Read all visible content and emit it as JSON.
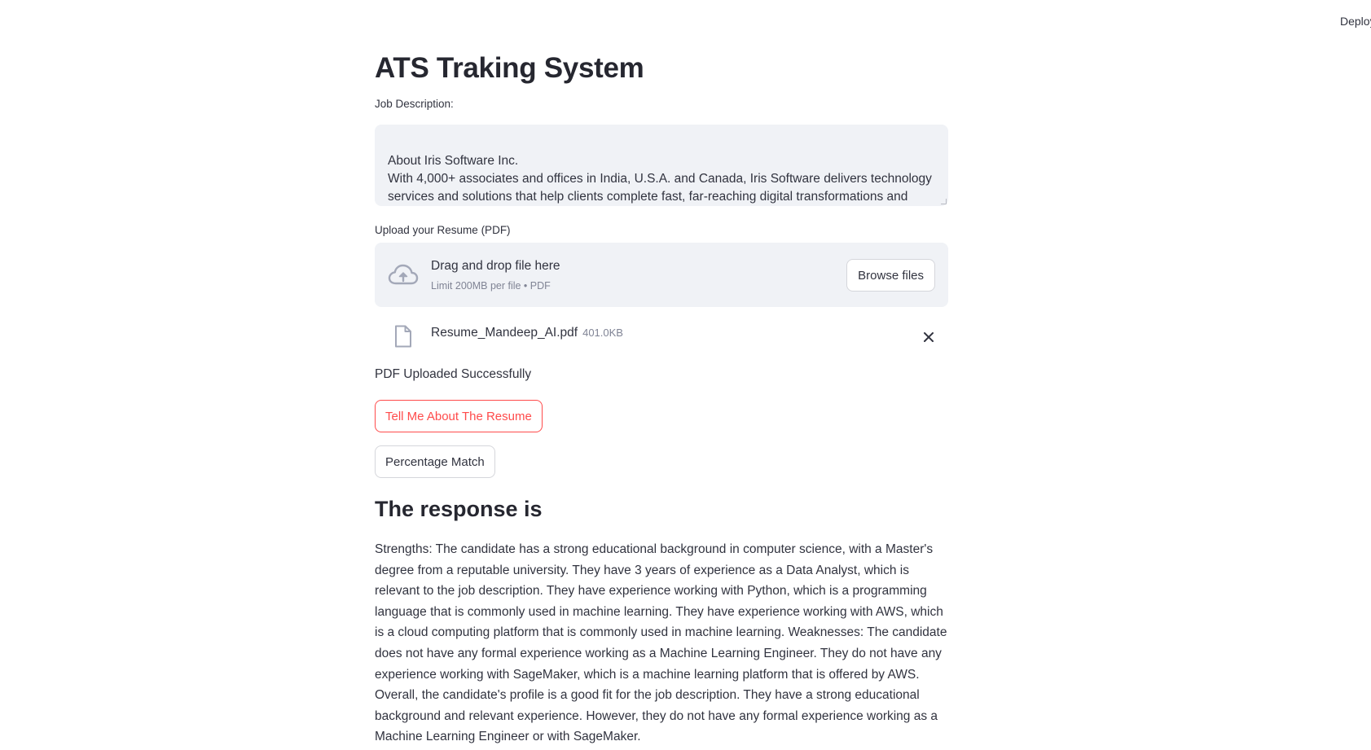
{
  "header": {
    "deploy_label": "Deploy"
  },
  "main": {
    "title": "ATS Traking System",
    "job_description": {
      "label": "Job Description:",
      "lines": [
        "",
        "About Iris Software Inc.",
        "With 4,000+ associates and offices in India, U.S.A. and Canada, Iris Software delivers technology",
        "services and solutions that help clients complete fast, far-reaching digital transformations and"
      ]
    },
    "upload": {
      "label": "Upload your Resume (PDF)",
      "dropzone_text": "Drag and drop file here",
      "dropzone_limit": "Limit 200MB per file • PDF",
      "browse_label": "Browse files",
      "file_name": "Resume_Mandeep_AI.pdf",
      "file_size": "401.0KB"
    },
    "status_message": "PDF Uploaded Successfully",
    "buttons": {
      "tell_me": "Tell Me About The Resume",
      "percentage_match": "Percentage Match"
    },
    "response": {
      "heading": "The response is",
      "body": "Strengths: The candidate has a strong educational background in computer science, with a Master's degree from a reputable university. They have 3 years of experience as a Data Analyst, which is relevant to the job description. They have experience working with Python, which is a programming language that is commonly used in machine learning. They have experience working with AWS, which is a cloud computing platform that is commonly used in machine learning. Weaknesses: The candidate does not have any formal experience working as a Machine Learning Engineer. They do not have any experience working with SageMaker, which is a machine learning platform that is offered by AWS. Overall, the candidate's profile is a good fit for the job description. They have a strong educational background and relevant experience. However, they do not have any formal experience working as a Machine Learning Engineer or with SageMaker."
    }
  },
  "icons": {
    "upload": "cloud-upload-icon",
    "file": "file-icon",
    "remove": "close-icon"
  },
  "colors": {
    "accent": "#ff4b4b",
    "input_background": "#f0f2f6",
    "text": "#31333f",
    "muted": "#808495",
    "icon": "#a3a8b8"
  }
}
